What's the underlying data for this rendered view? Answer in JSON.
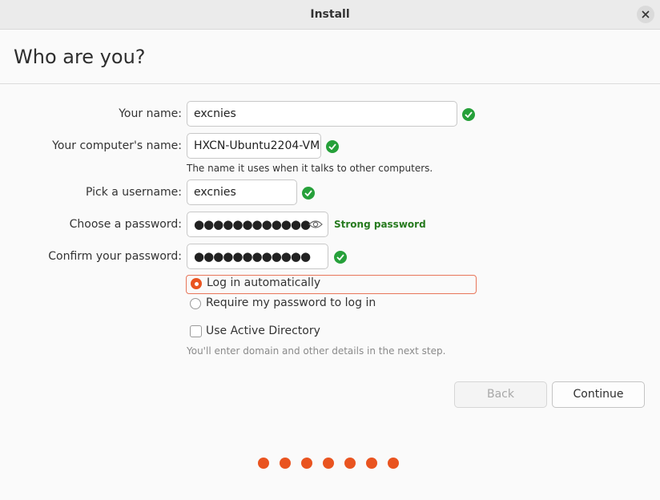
{
  "window": {
    "title": "Install"
  },
  "page": {
    "heading": "Who are you?"
  },
  "form": {
    "name": {
      "label": "Your name:",
      "value": "excnies",
      "valid": true
    },
    "computer": {
      "label": "Your computer's name:",
      "value": "HXCN-Ubuntu2204-VM",
      "hint": "The name it uses when it talks to other computers.",
      "valid": true
    },
    "username": {
      "label": "Pick a username:",
      "value": "excnies",
      "valid": true
    },
    "password": {
      "label": "Choose a password:",
      "value": "●●●●●●●●●●●●",
      "strength": "Strong password"
    },
    "confirm": {
      "label": "Confirm your password:",
      "value": "●●●●●●●●●●●●",
      "valid": true
    },
    "login_options": [
      {
        "label": "Log in automatically",
        "selected": true
      },
      {
        "label": "Require my password to log in",
        "selected": false
      }
    ],
    "active_directory": {
      "label": "Use Active Directory",
      "checked": false,
      "hint": "You'll enter domain and other details in the next step."
    }
  },
  "buttons": {
    "back": "Back",
    "continue": "Continue"
  },
  "progress": {
    "steps": 7
  },
  "colors": {
    "accent": "#E95420",
    "valid": "#26A03A",
    "strength": "#267A1E"
  }
}
